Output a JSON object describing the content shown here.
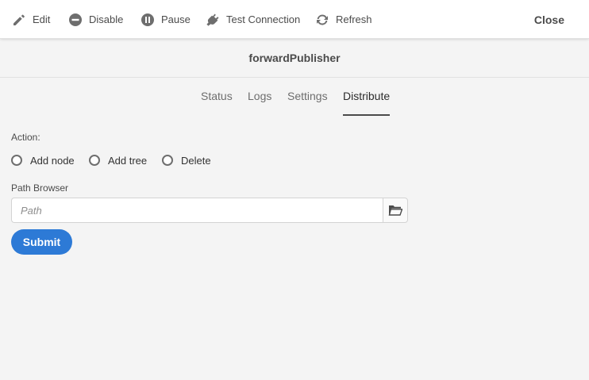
{
  "toolbar": {
    "edit_label": "Edit",
    "disable_label": "Disable",
    "pause_label": "Pause",
    "test_connection_label": "Test Connection",
    "refresh_label": "Refresh",
    "close_label": "Close"
  },
  "title": "forwardPublisher",
  "tabs": [
    {
      "label": "Status",
      "active": false
    },
    {
      "label": "Logs",
      "active": false
    },
    {
      "label": "Settings",
      "active": false
    },
    {
      "label": "Distribute",
      "active": true
    }
  ],
  "form": {
    "action_label": "Action:",
    "actions": [
      {
        "label": "Add node",
        "selected": false
      },
      {
        "label": "Add tree",
        "selected": false
      },
      {
        "label": "Delete",
        "selected": false
      }
    ],
    "path_browser_label": "Path Browser",
    "path_placeholder": "Path",
    "path_value": "",
    "submit_label": "Submit"
  },
  "colors": {
    "accent": "#2d7ad6",
    "background": "#f4f4f4",
    "toolbar": "#ffffff"
  },
  "icons": [
    "pencil-icon",
    "disable-icon",
    "pause-icon",
    "plug-icon",
    "refresh-icon",
    "folder-icon"
  ]
}
